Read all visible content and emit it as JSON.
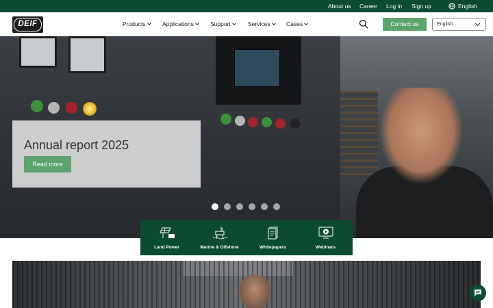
{
  "topbar": {
    "links": [
      "About us",
      "Career",
      "Log in",
      "Sign up"
    ],
    "language": "English",
    "icon": "globe-icon"
  },
  "header": {
    "logo_text": "DEIF",
    "nav": [
      "Products",
      "Applications",
      "Support",
      "Services",
      "Cases"
    ],
    "search_icon": "search-icon",
    "contact_label": "Contact us",
    "language_select": {
      "value": "English",
      "options": [
        "English"
      ]
    }
  },
  "hero": {
    "title": "Annual report 2025",
    "button_label": "Read more",
    "slides_total": 6,
    "active_slide": 1
  },
  "categories": [
    {
      "label": "Land Power",
      "icon": "solar-panel-icon"
    },
    {
      "label": "Marine & Offshore",
      "icon": "offshore-rig-icon"
    },
    {
      "label": "Whitepapers",
      "icon": "document-icon"
    },
    {
      "label": "Webinars",
      "icon": "video-play-icon"
    }
  ],
  "chat": {
    "icon": "chat-icon"
  },
  "colors": {
    "brand_dark_green": "#0c4a32",
    "accent_green": "#5da36d",
    "text": "#1d1d1b"
  }
}
